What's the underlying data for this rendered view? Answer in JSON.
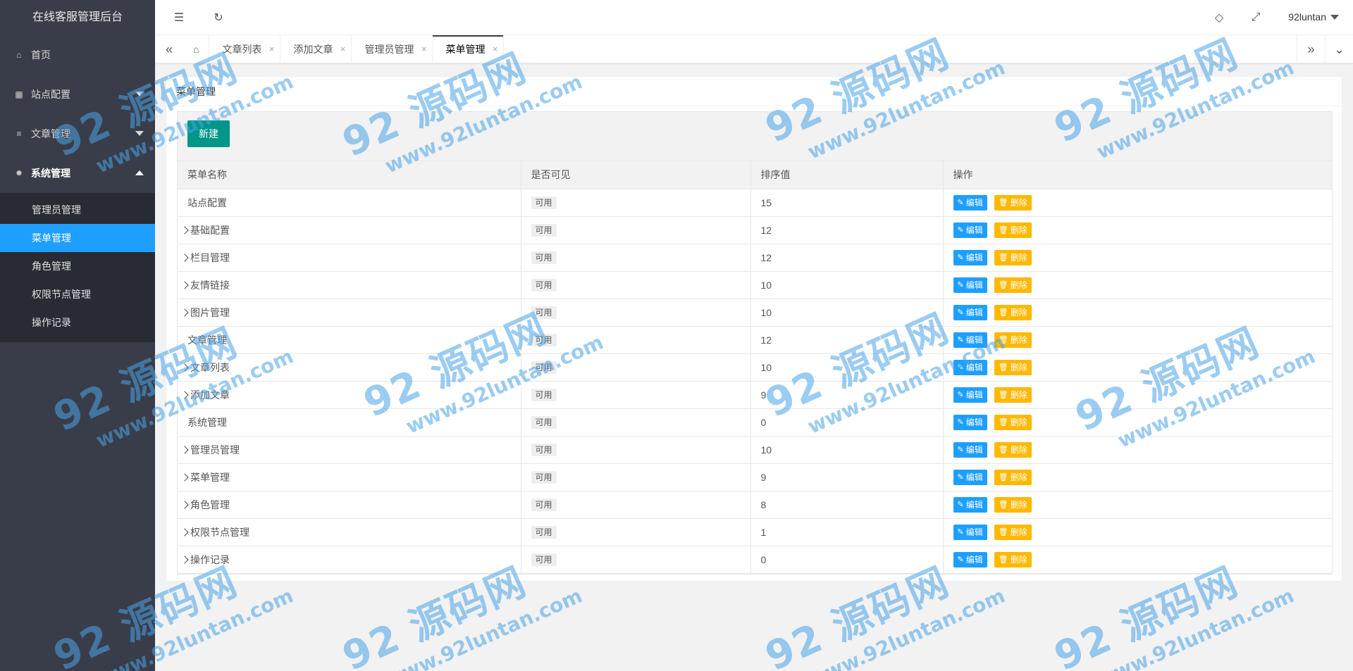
{
  "app": {
    "title": "在线客服管理后台"
  },
  "sidebar": {
    "items": [
      {
        "label": "首页",
        "icon": "home-icon"
      },
      {
        "label": "站点配置",
        "icon": "calendar-icon"
      },
      {
        "label": "文章管理",
        "icon": "document-icon"
      },
      {
        "label": "系统管理",
        "icon": "gear-icon"
      }
    ],
    "sub_items": [
      {
        "label": "管理员管理"
      },
      {
        "label": "菜单管理"
      },
      {
        "label": "角色管理"
      },
      {
        "label": "权限节点管理"
      },
      {
        "label": "操作记录"
      }
    ]
  },
  "header": {
    "user": "92luntan"
  },
  "tabs": [
    {
      "label": "文章列表"
    },
    {
      "label": "添加文章"
    },
    {
      "label": "管理员管理"
    },
    {
      "label": "菜单管理"
    }
  ],
  "page": {
    "title": "菜单管理",
    "new_button": "新建",
    "columns": [
      "菜单名称",
      "是否可见",
      "排序值",
      "操作"
    ],
    "edit_label": "编辑",
    "delete_label": "删除",
    "rows": [
      {
        "name": "站点配置",
        "child": false,
        "visible": "可用",
        "sort": "15"
      },
      {
        "name": "基础配置",
        "child": true,
        "visible": "可用",
        "sort": "12"
      },
      {
        "name": "栏目管理",
        "child": true,
        "visible": "可用",
        "sort": "12"
      },
      {
        "name": "友情链接",
        "child": true,
        "visible": "可用",
        "sort": "10"
      },
      {
        "name": "图片管理",
        "child": true,
        "visible": "可用",
        "sort": "10"
      },
      {
        "name": "文章管理",
        "child": false,
        "visible": "可用",
        "sort": "12"
      },
      {
        "name": "文章列表",
        "child": true,
        "visible": "可用",
        "sort": "10"
      },
      {
        "name": "添加文章",
        "child": true,
        "visible": "可用",
        "sort": "9"
      },
      {
        "name": "系统管理",
        "child": false,
        "visible": "可用",
        "sort": "0"
      },
      {
        "name": "管理员管理",
        "child": true,
        "visible": "可用",
        "sort": "10"
      },
      {
        "name": "菜单管理",
        "child": true,
        "visible": "可用",
        "sort": "9"
      },
      {
        "name": "角色管理",
        "child": true,
        "visible": "可用",
        "sort": "8"
      },
      {
        "name": "权限节点管理",
        "child": true,
        "visible": "可用",
        "sort": "1"
      },
      {
        "name": "操作记录",
        "child": true,
        "visible": "可用",
        "sort": "0"
      }
    ]
  },
  "watermark": {
    "big": "92 源码网",
    "small": "www.92luntan.com"
  },
  "colors": {
    "sidebar": "#393d49",
    "sidebar_sub": "#282b33",
    "accent": "#1e9fff",
    "primary": "#009688",
    "warn": "#ffb800"
  }
}
